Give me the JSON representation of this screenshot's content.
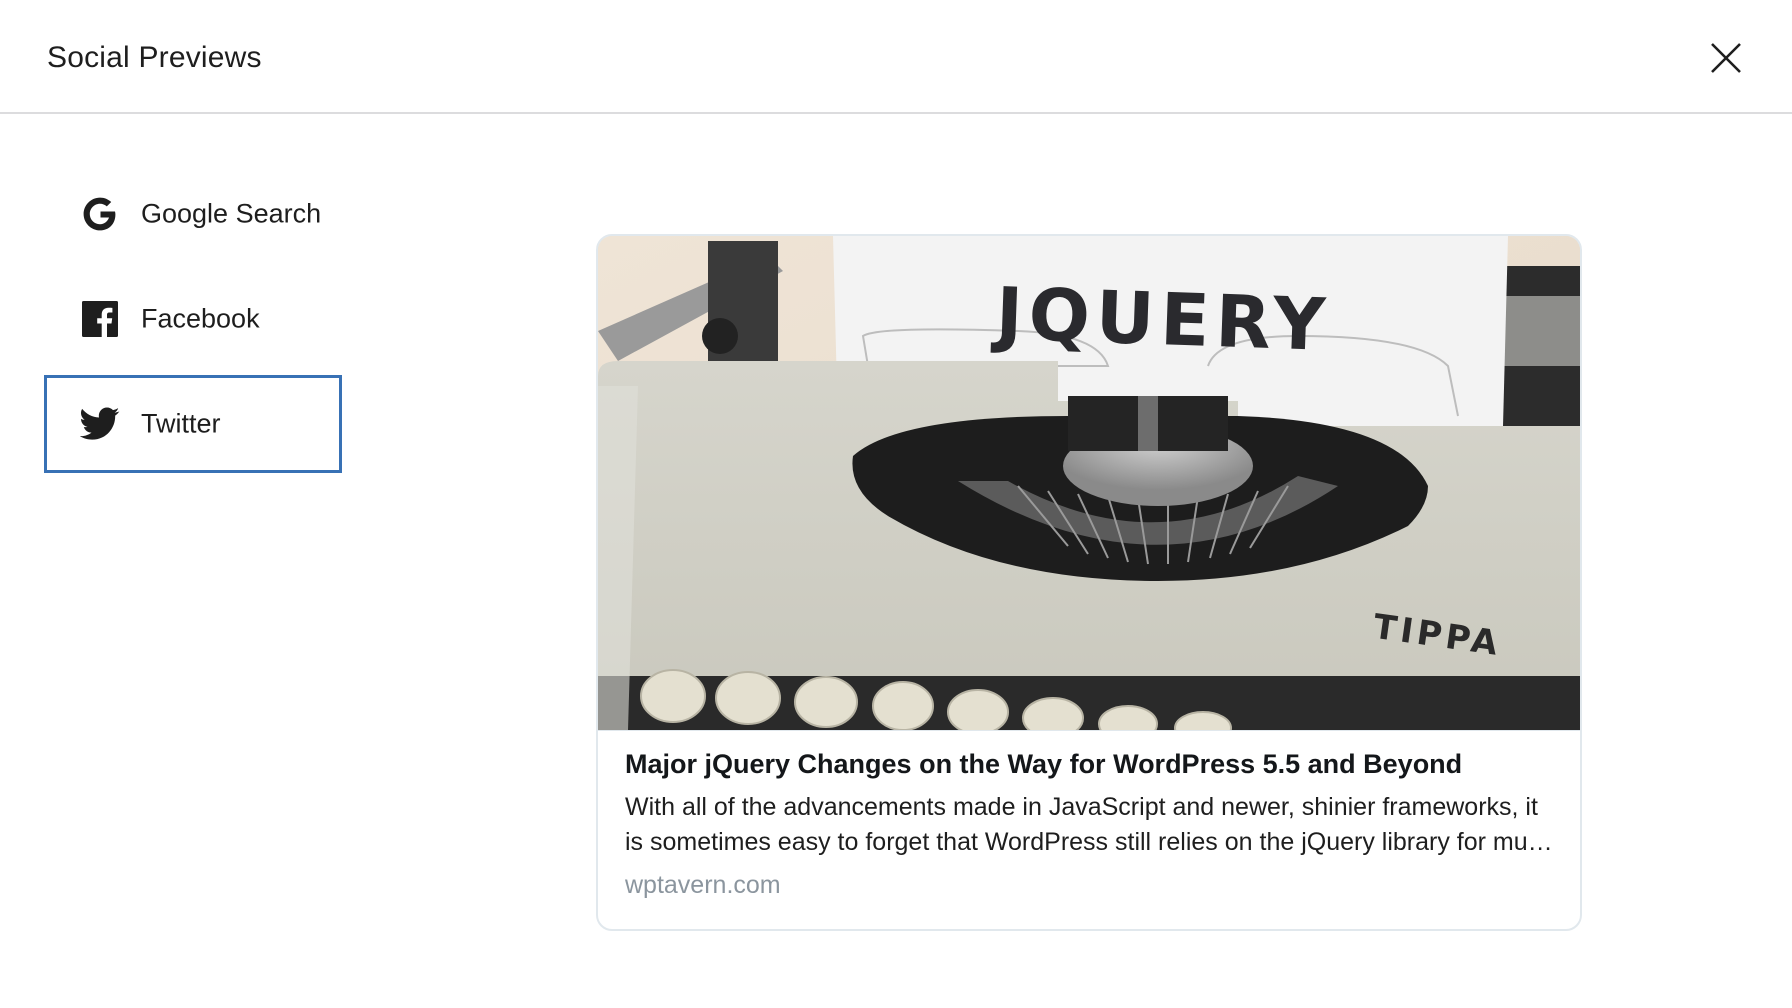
{
  "modal": {
    "title": "Social Previews",
    "close_label": "Close"
  },
  "tabs": [
    {
      "id": "google",
      "label": "Google Search",
      "icon": "google-icon",
      "active": false
    },
    {
      "id": "facebook",
      "label": "Facebook",
      "icon": "facebook-icon",
      "active": false
    },
    {
      "id": "twitter",
      "label": "Twitter",
      "icon": "twitter-icon",
      "active": true
    }
  ],
  "preview": {
    "image_text": "JQUERY",
    "image_brand_text": "TIPPA",
    "title": "Major jQuery Changes on the Way for WordPress 5.5 and Beyond",
    "description": "With all of the advancements made in JavaScript and newer, shinier frameworks, it is sometimes easy to forget that WordPress still relies on the jQuery library for much of its interactivity.",
    "domain": "wptavern.com"
  },
  "colors": {
    "active_border": "#3871b5",
    "domain_text": "#8b959e",
    "header_divider": "#dcdcde"
  }
}
